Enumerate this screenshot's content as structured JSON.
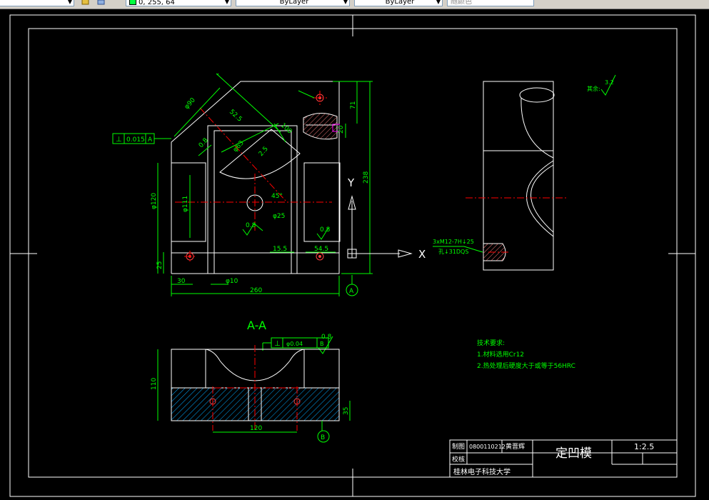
{
  "toolbar": {
    "color_value": "0, 255, 64",
    "linetype_value": "ByLayer",
    "lineweight_value": "ByLayer",
    "plotstyle_value": "随颜色"
  },
  "colors": {
    "background": "#000000",
    "outline": "#ffffff",
    "dimension": "#00ff00",
    "centerline": "#ff0000",
    "hatch": "#00aaff",
    "accent": "#ff00ff"
  },
  "drawing": {
    "main_view": {
      "dims": {
        "phi90": "φ90",
        "d52_5": "52.5",
        "d100": "100",
        "phi63": "φ63",
        "r6a": "0.8",
        "r6b": "2.5",
        "r6c": "0.8",
        "phi120": "φ120",
        "phi111": "φ111",
        "d25_left": "25",
        "d30": "30",
        "phi10": "φ10",
        "d260": "260",
        "angle45": "45°",
        "phi25": "φ25",
        "d15_5": "15.5",
        "d54_5": "54.5",
        "d71": "71",
        "d20": "20",
        "d238": "238",
        "rough1": "0.8",
        "rough2": "0.8"
      },
      "gdt_symbol": "⊥",
      "gdt_value": "0.015",
      "gdt_datum": "A",
      "y_label": "Y",
      "x_label": "X",
      "datum_a": "A"
    },
    "side_view": {
      "thread_note_1": "3xM12-7H↓25",
      "thread_note_2": "孔↓31DQS",
      "roughness_label": "其余:",
      "roughness_value": "3.2"
    },
    "section": {
      "title": "A-A",
      "gdt_symbol": "⊥",
      "gdt_value": "φ0.04",
      "gdt_datum": "B",
      "rough": "0.8",
      "d110": "110",
      "d120": "120",
      "d35": "35",
      "datum_b": "B"
    },
    "notes": {
      "heading": "技术要求:",
      "line1": "1.材料选用Cr12",
      "line2": "2.热处理后硬度大于或等于56HRC"
    },
    "title_block": {
      "drawn_by_label": "制图",
      "student_id": "0800110212",
      "name": "黄晋辉",
      "checked_label": "校核",
      "part_name": "定凹模",
      "scale": "1:2.5",
      "school": "桂林电子科技大学"
    }
  }
}
